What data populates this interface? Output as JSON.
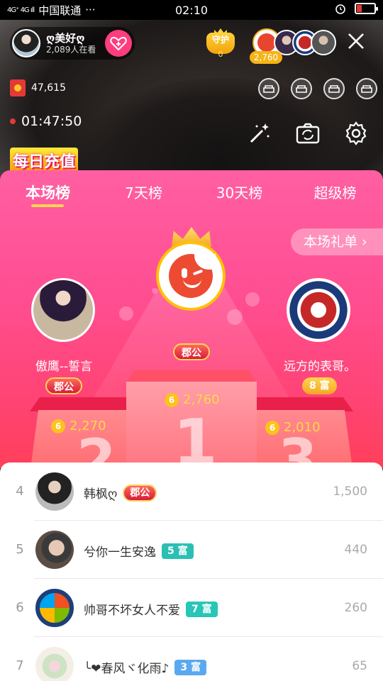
{
  "status_bar": {
    "signal": "4G⁺ 4G ıll",
    "carrier": "中国联通",
    "dots": "···",
    "time": "02:10"
  },
  "host": {
    "name": "ღ美好ღ",
    "viewers": "2,089人在看"
  },
  "guard": {
    "label": "守护",
    "count": "0"
  },
  "top_viewer_score": "2,760",
  "coins": "47,615",
  "live_timer": "01:47:50",
  "daily_recharge": "每日充值",
  "tabs": [
    "本场榜",
    "7天榜",
    "30天榜",
    "超级榜"
  ],
  "gift_list_button": "本场礼单 ›",
  "podium": {
    "first": {
      "badge": "郡公",
      "score": "2,760"
    },
    "second": {
      "name": "傲鹰--誓言",
      "badge": "郡公",
      "score": "2,270",
      "number": "2"
    },
    "third": {
      "name": "远方的表哥。",
      "badge": "8 富",
      "score": "2,010",
      "number": "3"
    },
    "first_number": "1",
    "coin_label": "6"
  },
  "list": [
    {
      "rank": "4",
      "name": "韩枫ღ",
      "badge": "郡公",
      "badge_type": "jungong",
      "score": "1,500"
    },
    {
      "rank": "5",
      "name": "兮你一生安逸",
      "badge": "5 富",
      "badge_type": "rich5",
      "score": "440"
    },
    {
      "rank": "6",
      "name": "帅哥不坏女人不爱",
      "badge": "7 富",
      "badge_type": "rich7",
      "score": "260"
    },
    {
      "rank": "7",
      "name": "╰❤春风ヾ化雨♪",
      "badge": "3 富",
      "badge_type": "rich3",
      "score": "65"
    }
  ],
  "colors": {
    "panel_top": "#ff5fa2",
    "panel_bottom": "#ff3f5a",
    "score_gold": "#ffd84a",
    "follow_pink": "#ff3d7f"
  }
}
